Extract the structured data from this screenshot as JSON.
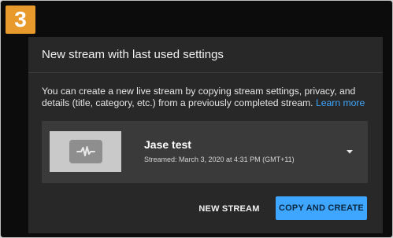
{
  "step_badge": "3",
  "dialog": {
    "title": "New stream with last used settings",
    "description": "You can create a new live stream by copying stream settings, privacy, and details (title, category, etc.) from a previously completed stream.",
    "learn_more": "Learn more"
  },
  "stream": {
    "title": "Jase test",
    "streamed": "Streamed: March 3, 2020 at 4:31 PM (GMT+11)",
    "thumbnail_icon": "live-pulse-icon",
    "dropdown_icon": "caret-down-icon"
  },
  "buttons": {
    "new_stream": "NEW STREAM",
    "copy_and_create": "COPY AND CREATE"
  },
  "colors": {
    "badge": "#e89a2c",
    "accent": "#3ea6ff",
    "dialog_bg": "#282828",
    "card_bg": "#3a3a3a"
  }
}
